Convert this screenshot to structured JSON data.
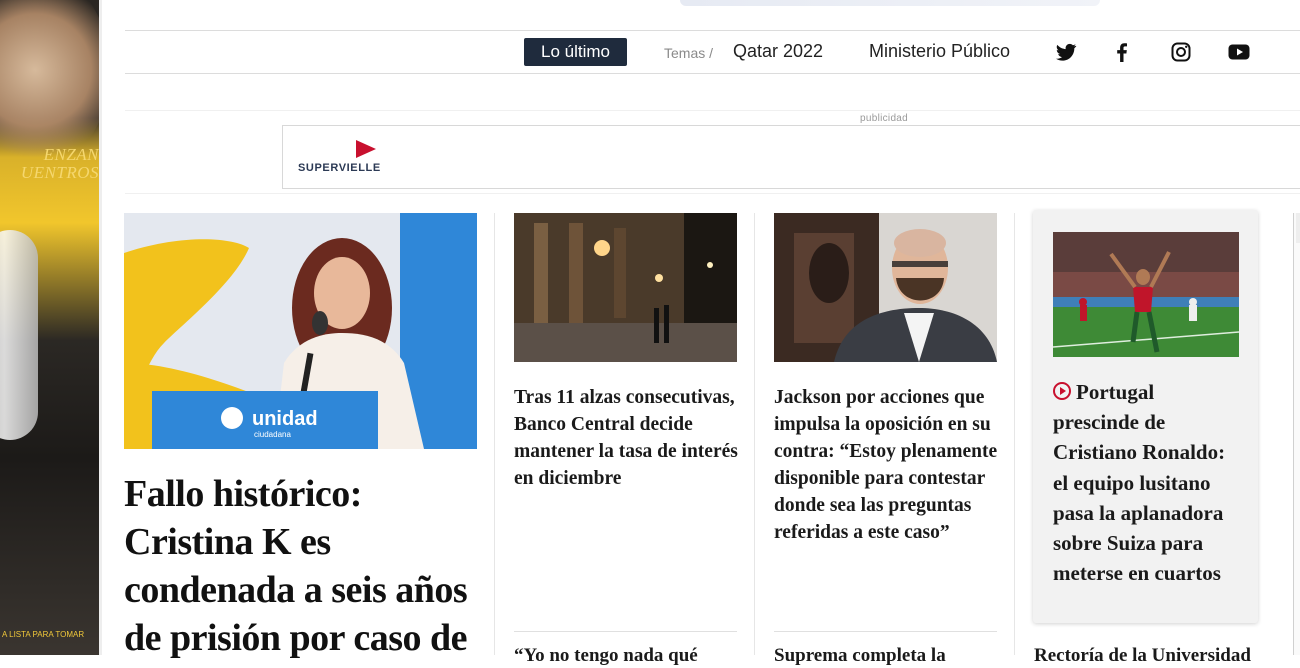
{
  "side_ad": {
    "line1": "ENZAN",
    "line2": "UENTROS",
    "footer": "A LISTA PARA TOMAR"
  },
  "nav": {
    "latest_label": "Lo último",
    "temas_label": "Temas /",
    "topics": [
      "Qatar 2022",
      "Ministerio Público"
    ],
    "social_icons": [
      "twitter-icon",
      "facebook-icon",
      "instagram-icon",
      "youtube-icon"
    ]
  },
  "ad": {
    "label": "publicidad",
    "advertiser": "SUPERVIELLE",
    "brand_color": "#c8102e"
  },
  "lead": {
    "title": "Fallo histórico: Cristina K es condenada a seis años de prisión por caso de",
    "image_alt": "Cristina Kirchner en un atril",
    "podium_text": "unidad",
    "podium_sub": "ciudadana"
  },
  "cards": [
    {
      "title": "Tras 11 alzas consecutivas, Banco Central decide mantener la tasa de interés en diciembre",
      "image_alt": "Fachada del Banco Central de noche"
    },
    {
      "title": "Jackson por acciones que impulsa la oposición en su contra: “Estoy plenamente disponible para contestar donde sea las preguntas referidas a este caso”",
      "image_alt": "Giorgio Jackson"
    }
  ],
  "featured": {
    "title": "Portugal prescinde de Cristiano Ronaldo: el equipo lusitano pasa la aplanadora sobre Suiza para meterse en cuartos",
    "icon": "play-circle-icon",
    "image_alt": "Jugador de Portugal celebrando"
  },
  "peeks": [
    "“Yo no tengo nada qué",
    "Suprema completa la",
    "Rectoría de la Universidad"
  ]
}
